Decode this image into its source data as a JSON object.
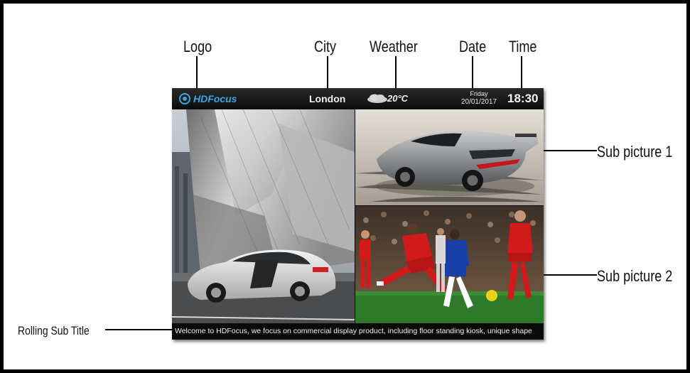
{
  "annotations": {
    "logo": "Logo",
    "city": "City",
    "weather": "Weather",
    "date": "Date",
    "time": "Time",
    "sub_picture_1": "Sub picture 1",
    "sub_picture_2": "Sub picture 2",
    "rolling_sub_title": "Rolling Sub Title"
  },
  "screen": {
    "logo_text": "HDFocus",
    "city": "London",
    "weather_icon": "cloud-icon",
    "temperature": "20°C",
    "day": "Friday",
    "date": "20/01/2017",
    "time": "18:30",
    "ticker": "Welcome to HDFocus, we focus on commercial display product, including floor standing kiosk, unique shape"
  },
  "colors": {
    "logo_accent": "#37a7e6",
    "bar_background": "#111111",
    "pitch_green": "#2f7a2a",
    "kit_red": "#d11a1a",
    "kit_blue": "#1b3fa8"
  }
}
